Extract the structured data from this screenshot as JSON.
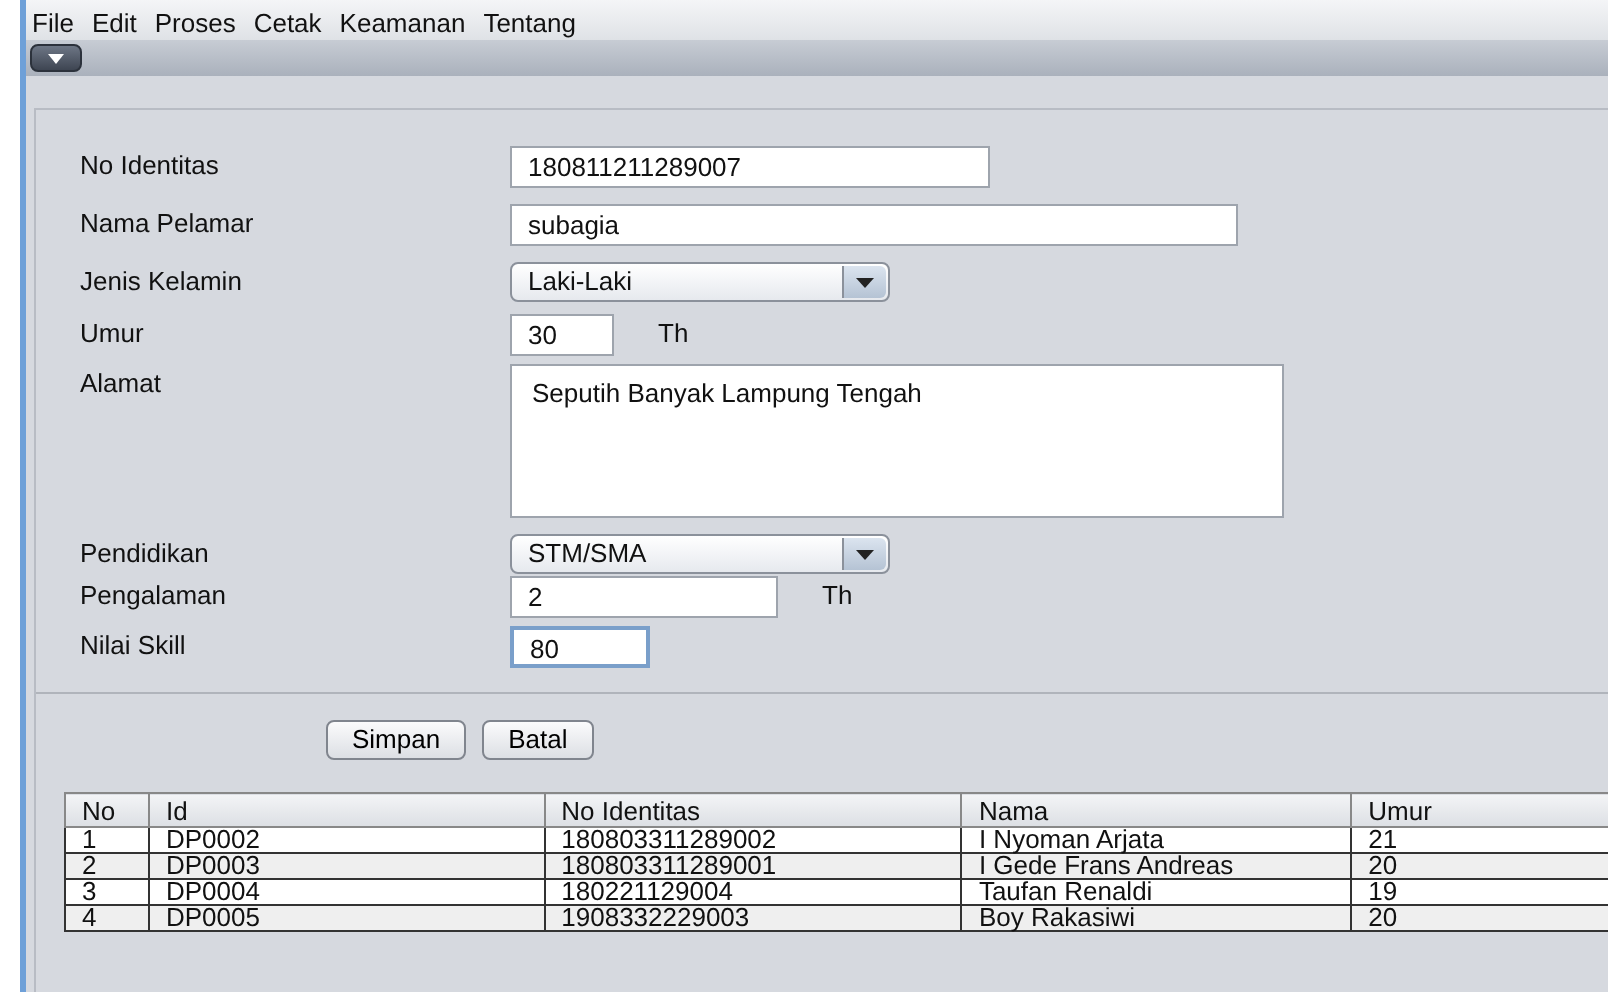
{
  "menu": [
    "File",
    "Edit",
    "Proses",
    "Cetak",
    "Keamanan",
    "Tentang"
  ],
  "form": [
    {
      "label": "No Identitas",
      "kind": "text",
      "value": "180811211289007",
      "focused": false
    },
    {
      "label": "Nama Pelamar",
      "kind": "text",
      "value": "subagia",
      "focused": false
    },
    {
      "label": "Jenis Kelamin",
      "kind": "combo",
      "value": "Laki-Laki"
    },
    {
      "label": "Umur",
      "kind": "text",
      "value": "30",
      "focused": false,
      "unit": "Th"
    },
    {
      "label": "Alamat",
      "kind": "area",
      "value": "Seputih Banyak Lampung Tengah"
    },
    {
      "label": "Pendidikan",
      "kind": "combo",
      "value": "STM/SMA"
    },
    {
      "label": "Pengalaman",
      "kind": "text",
      "value": "2",
      "focused": false,
      "unit": "Th"
    },
    {
      "label": "Nilai Skill",
      "kind": "text",
      "value": "80",
      "focused": true
    }
  ],
  "buttons": [
    "Simpan",
    "Batal"
  ],
  "table": {
    "columns": [
      "No",
      "Id",
      "No Identitas",
      "Nama",
      "Umur"
    ],
    "rows": [
      [
        "1",
        "DP0002",
        "180803311289002",
        "I Nyoman Arjata",
        "21"
      ],
      [
        "2",
        "DP0003",
        "180803311289001",
        "I Gede Frans Andreas",
        "20"
      ],
      [
        "3",
        "DP0004",
        "180221129004",
        "Taufan Renaldi",
        "19"
      ],
      [
        "4",
        "DP0005",
        "1908332229003",
        "Boy Rakasiwi",
        "20"
      ]
    ]
  }
}
